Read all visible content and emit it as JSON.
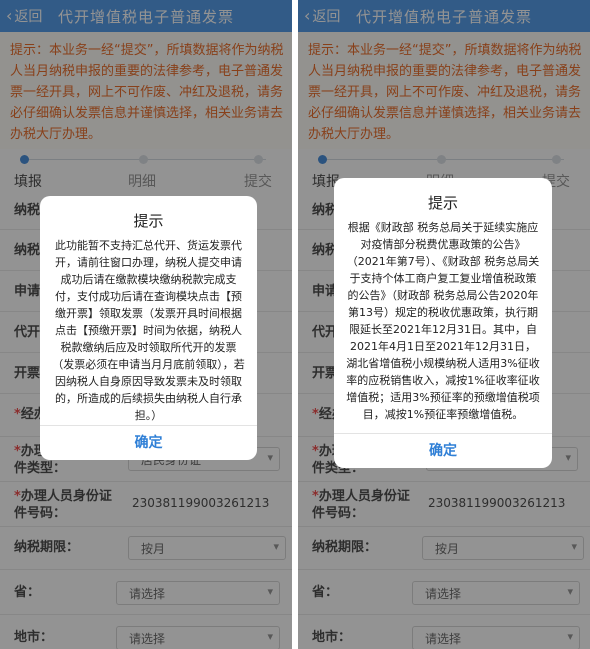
{
  "header": {
    "back_label": "返回",
    "title": "代开增值税电子普通发票"
  },
  "notice": "提示：本业务一经“提交”，所填数据将作为纳税人当月纳税申报的重要的法律参考，电子普通发票一经开具，网上不可作废、冲红及退税，请务必仔细确认发票信息并谨慎选择，相关业务请去办税大厅办理。",
  "steps": [
    "填报",
    "明细",
    "提交"
  ],
  "form": {
    "taxpayer_label": "纳税人",
    "taxpayer_label_right": "纳税人",
    "taxpayer_value": "",
    "category_label": "纳税人分",
    "apply_label": "申请",
    "agent_label": "代开",
    "invoice_label": "开票",
    "invoice_label_right": "开票",
    "tax_label": "*经办",
    "tax_label_right": "*经办",
    "agent_id_type_label": "*办理人员身份证件类型：",
    "agent_id_type_value": "居民身份证",
    "agent_id_no_label": "*办理人员身份证件号码：",
    "agent_id_no_value": "230381199003261213",
    "period_label": "纳税期限：",
    "period_value": "按月",
    "province_label": "省：",
    "province_placeholder": "请选择",
    "city_label": "地市：",
    "city_placeholder": "请选择"
  },
  "dialog_left": {
    "title": "提示",
    "body": "此功能暂不支持汇总代开、货运发票代开，请前往窗口办理，纳税人提交申请成功后请在缴款模块缴纳税款完成支付，支付成功后请在查询模块点击【预缴开票】领取发票（发票开具时间根据点击【预缴开票】时间为依据，纳税人税款缴纳后应及时领取所代开的发票（发票必须在申请当月月底前领取），若因纳税人自身原因导致发票未及时领取的，所造成的后续损失由纳税人自行承担。）",
    "button": "确定"
  },
  "dialog_right": {
    "title": "提示",
    "body": "根据《财政部 税务总局关于延续实施应对疫情部分税费优惠政策的公告》（2021年第7号）、《财政部 税务总局关于支持个体工商户复工复业增值税政策的公告》（财政部 税务总局公告2020年第13号）规定的税收优惠政策，执行期限延长至2021年12月31日。其中，自2021年4月1日至2021年12月31日，湖北省增值税小规模纳税人适用3%征收率的应税销售收入，减按1%征收率征收增值税；适用3%预征率的预缴增值税项目，减按1%预征率预缴增值税。",
    "button": "确定"
  },
  "colors": {
    "topbar": "#3d8ee6",
    "notice_text": "#e8590c",
    "accent": "#2f7fd6",
    "required": "#ee3333"
  }
}
